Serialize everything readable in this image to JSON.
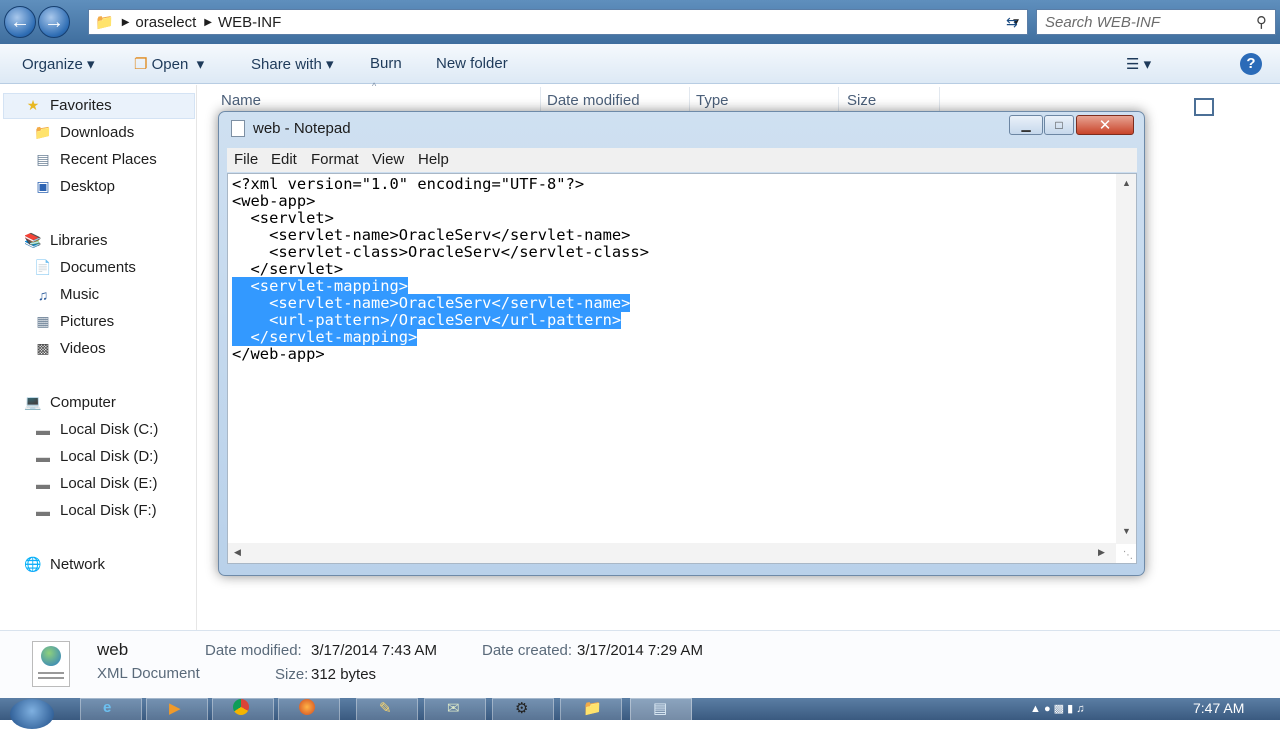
{
  "explorer": {
    "address": {
      "crumbs": [
        "oraselect",
        "WEB-INF"
      ]
    },
    "search": {
      "placeholder": "Search WEB-INF"
    },
    "toolbar": {
      "organize": "Organize",
      "open": "Open",
      "share_with": "Share with",
      "burn": "Burn",
      "new_folder": "New folder"
    },
    "columns": {
      "name": "Name",
      "date_modified": "Date modified",
      "type": "Type",
      "size": "Size"
    },
    "sidebar": {
      "favorites": "Favorites",
      "favorites_items": [
        "Downloads",
        "Recent Places",
        "Desktop"
      ],
      "libraries": "Libraries",
      "libraries_items": [
        "Documents",
        "Music",
        "Pictures",
        "Videos"
      ],
      "computer": "Computer",
      "computer_items": [
        "Local Disk (C:)",
        "Local Disk (D:)",
        "Local Disk (E:)",
        "Local Disk (F:)"
      ],
      "network": "Network"
    },
    "details": {
      "file_name": "web",
      "file_type": "XML Document",
      "date_modified_label": "Date modified:",
      "date_modified": "3/17/2014 7:43 AM",
      "size_label": "Size:",
      "size": "312 bytes",
      "date_created_label": "Date created:",
      "date_created": "3/17/2014 7:29 AM"
    }
  },
  "notepad": {
    "title": "web - Notepad",
    "menu": [
      "File",
      "Edit",
      "Format",
      "View",
      "Help"
    ],
    "lines": [
      {
        "text": "<?xml version=\"1.0\" encoding=\"UTF-8\"?>",
        "selected": false
      },
      {
        "text": "<web-app>",
        "selected": false
      },
      {
        "text": "  <servlet>",
        "selected": false
      },
      {
        "text": "    <servlet-name>OracleServ</servlet-name>",
        "selected": false
      },
      {
        "text": "    <servlet-class>OracleServ</servlet-class>",
        "selected": false
      },
      {
        "text": "  </servlet>",
        "selected": false
      },
      {
        "text": "  <servlet-mapping>",
        "selected": true
      },
      {
        "text": "    <servlet-name>OracleServ</servlet-name>",
        "selected": true
      },
      {
        "text": "    <url-pattern>/OracleServ</url-pattern>",
        "selected": true
      },
      {
        "text": "  </servlet-mapping>",
        "selected": true
      },
      {
        "text": "</web-app>",
        "selected": false
      }
    ]
  },
  "taskbar": {
    "clock": "7:47 AM"
  }
}
